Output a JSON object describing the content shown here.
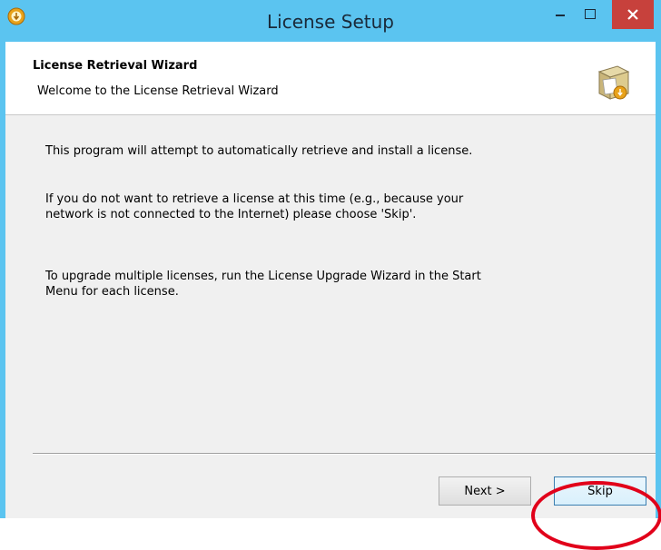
{
  "window": {
    "title": "License Setup",
    "close_glyph": "✕",
    "minimize_glyph": "–",
    "maximize_glyph": "☐"
  },
  "header": {
    "title": "License Retrieval Wizard",
    "subtitle": "Welcome to the License Retrieval Wizard",
    "icon": "license-box-icon"
  },
  "body": {
    "paragraph1": "This program will attempt to automatically retrieve and install a license.",
    "paragraph2": "If you do not want to retrieve a license at this time (e.g., because your\nnetwork is not connected to the Internet) please choose 'Skip'.",
    "paragraph3": "To upgrade multiple licenses, run the License Upgrade Wizard in the Start\nMenu for each license."
  },
  "buttons": {
    "next_label": "Next >",
    "skip_label": "Skip"
  },
  "colors": {
    "titlebar": "#5bc4f0",
    "close_button": "#c7413c",
    "highlight_ring": "#e1001a"
  }
}
